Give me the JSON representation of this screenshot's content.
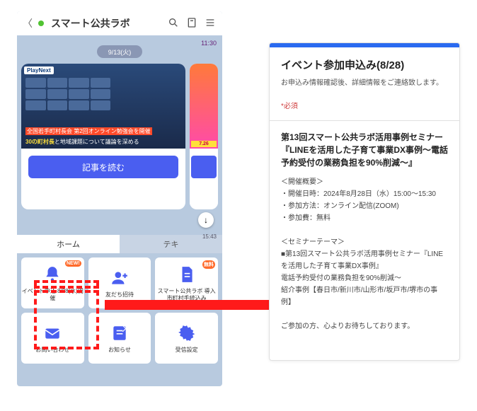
{
  "header": {
    "title": "スマート公共ラボ",
    "time_top": "11:30"
  },
  "chat": {
    "date_pill": "9/13(火)",
    "hero_tag": "PlayNext",
    "hero_overlay_l1": "全国若手町村長会 第2回オンライン勉強会を開催",
    "hero_overlay_l2a": "30の町村長",
    "hero_overlay_l2b": "と地域課題について議論を深める",
    "read_button": "記事を読む",
    "side_date": "7.26",
    "download_icon": "↓",
    "timestamp": "15:43"
  },
  "tabs": {
    "home": "ホーム",
    "deck": "テキ"
  },
  "tiles": [
    {
      "label": "イベント申込\n8/28(水)開催",
      "badge": "NEW!",
      "icon": "bell"
    },
    {
      "label": "友だち招待",
      "badge": null,
      "icon": "person"
    },
    {
      "label": "スマート公共ラボ\n導入市町村手続込み",
      "badge": "無料",
      "icon": "doc"
    },
    {
      "label": "お問い合わせ",
      "badge": null,
      "icon": "mail"
    },
    {
      "label": "お知らせ",
      "badge": null,
      "icon": "note"
    },
    {
      "label": "受信設定",
      "badge": null,
      "icon": "gear"
    }
  ],
  "form": {
    "title": "イベント参加申込み(8/28)",
    "desc": "お申込み情報確認後、詳細情報をご連絡致します。",
    "required": "*必須",
    "seminar_title": "第13回スマート公共ラボ活用事例セミナー『LINEを活用した子育て事業DX事例〜電話予約受付の業務負担を90%削減〜』",
    "overview_label": "＜開催概要＞",
    "date_label": "・開催日時：",
    "date_value": "2024年8月28日（水）15:00〜15:30",
    "method_label": "・参加方法：",
    "method_value": "オンライン配信(ZOOM)",
    "fee_label": "・参加費：",
    "fee_value": "無料",
    "theme_label": "＜セミナーテーマ＞",
    "theme_1": "■第13回スマート公共ラボ活用事例セミナー『LINEを活用した子育て事業DX事例』",
    "theme_2": "電話予約受付の業務負担を90%削減〜",
    "theme_3": "紹介事例【春日市/新川市/山形市/坂戸市/堺市の事例】",
    "closing": "ご参加の方、心よりお待ちしております。"
  }
}
